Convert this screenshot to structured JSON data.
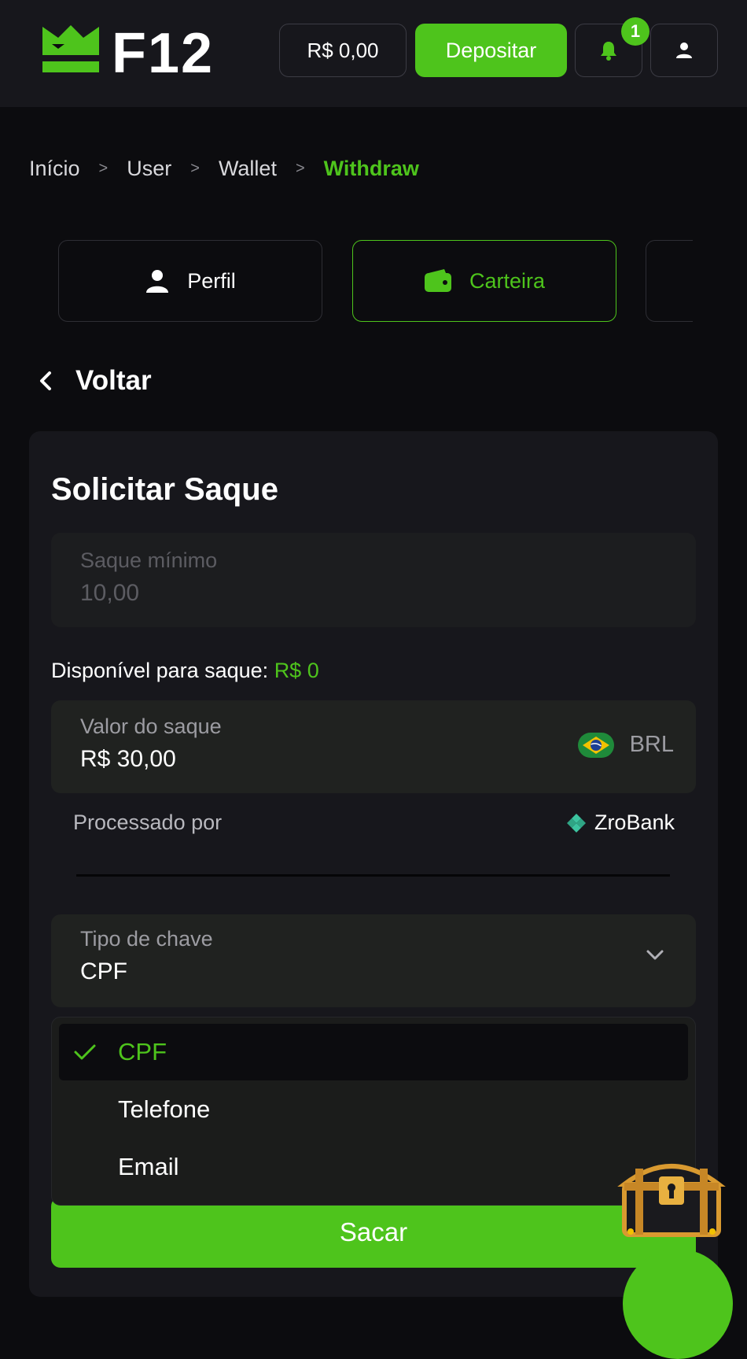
{
  "header": {
    "logo_text": "F12",
    "balance": "R$ 0,00",
    "deposit_label": "Depositar",
    "notification_count": "1",
    "icons": [
      "crown-logo-icon",
      "bell-icon",
      "user-icon"
    ]
  },
  "breadcrumb": {
    "items": [
      "Início",
      "User",
      "Wallet",
      "Withdraw"
    ],
    "separator": ">"
  },
  "tabs": [
    {
      "label": "Perfil",
      "icon": "user-icon",
      "active": false
    },
    {
      "label": "Carteira",
      "icon": "wallet-icon",
      "active": true
    }
  ],
  "back_label": "Voltar",
  "withdraw": {
    "title": "Solicitar Saque",
    "min_label": "Saque mínimo",
    "min_value": "10,00",
    "available_label": "Disponível para saque:",
    "available_amount": "R$ 0",
    "amount_label": "Valor do saque",
    "amount_value": "R$ 30,00",
    "currency": "BRL",
    "processed_label": "Processado por",
    "provider": "ZroBank",
    "key_type_label": "Tipo de chave",
    "key_type_value": "CPF",
    "key_type_options": [
      "CPF",
      "Telefone",
      "Email"
    ],
    "submit_label": "Sacar"
  },
  "colors": {
    "accent": "#4ec41c",
    "background": "#0c0c0f",
    "header_bg": "#17171c",
    "card_bg": "#17171c"
  }
}
